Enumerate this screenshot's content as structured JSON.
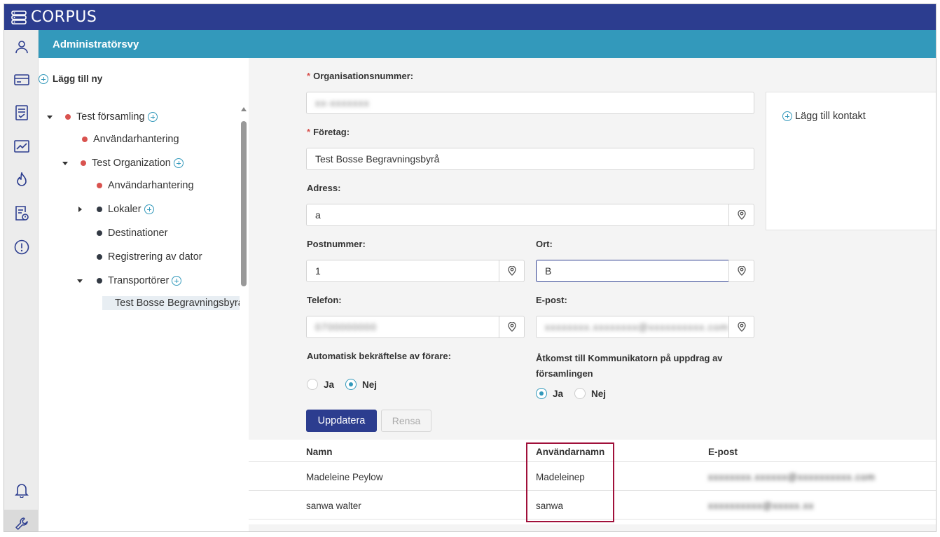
{
  "app": {
    "brand": "CORPUS",
    "logo_icon": "server-stack-icon"
  },
  "nav": {
    "items": [
      {
        "icon": "user-icon"
      },
      {
        "icon": "card-icon"
      },
      {
        "icon": "document-list-icon"
      },
      {
        "icon": "chart-icon"
      },
      {
        "icon": "flame-icon"
      },
      {
        "icon": "report-icon"
      },
      {
        "icon": "alert-icon"
      },
      {
        "icon": "bell-icon"
      },
      {
        "icon": "wrench-icon",
        "active": true
      }
    ]
  },
  "header": {
    "title": "Administratörsvy"
  },
  "tree": {
    "add_new_label": "Lägg till ny",
    "nodes": [
      {
        "label": "Test församling",
        "dot": "red",
        "addable": true,
        "expanded": true
      },
      {
        "label": "Användarhantering",
        "dot": "red"
      },
      {
        "label": "Test Organization",
        "dot": "red",
        "addable": true,
        "expanded": true
      },
      {
        "label": "Användarhantering",
        "dot": "red"
      },
      {
        "label": "Lokaler",
        "dot": "dark",
        "addable": true,
        "expanded": false
      },
      {
        "label": "Destinationer",
        "dot": "dark"
      },
      {
        "label": "Registrering av dator",
        "dot": "dark"
      },
      {
        "label": "Transportörer",
        "dot": "dark",
        "addable": true,
        "expanded": true
      },
      {
        "label": "Test Bosse Begravningsbyrå",
        "dot": "dark",
        "selected": true
      }
    ]
  },
  "form": {
    "org_number": {
      "label": "Organisationsnummer",
      "required": true,
      "value": "xx-xxxxxxx"
    },
    "company": {
      "label": "Företag",
      "required": true,
      "value": "Test Bosse Begravningsbyrå"
    },
    "address": {
      "label": "Adress",
      "value": "a"
    },
    "postal_code": {
      "label": "Postnummer",
      "value": "1"
    },
    "city": {
      "label": "Ort",
      "value": "B"
    },
    "phone": {
      "label": "Telefon",
      "value": "0700000000"
    },
    "email": {
      "label": "E-post",
      "value": "xxxxxxxx.xxxxxxxx@xxxxxxxxxx.com"
    },
    "auto_confirm": {
      "label": "Automatisk bekräftelse av förare",
      "options": [
        "Ja",
        "Nej"
      ],
      "selected": "Nej"
    },
    "access": {
      "label": "Åtkomst till Kommunikatorn på uppdrag av församlingen",
      "options": [
        "Ja",
        "Nej"
      ],
      "selected": "Ja"
    },
    "update_label": "Uppdatera",
    "clear_label": "Rensa"
  },
  "contacts": {
    "add_label": "Lägg till kontakt"
  },
  "table": {
    "columns": [
      "Namn",
      "Användarnamn",
      "E-post"
    ],
    "rows": [
      {
        "name": "Madeleine Peylow",
        "username": "Madeleinep",
        "email": "xxxxxxxx.xxxxxx@xxxxxxxxxx.com"
      },
      {
        "name": "sanwa walter",
        "username": "sanwa",
        "email": "xxxxxxxxxx@xxxxx.xx"
      }
    ]
  }
}
